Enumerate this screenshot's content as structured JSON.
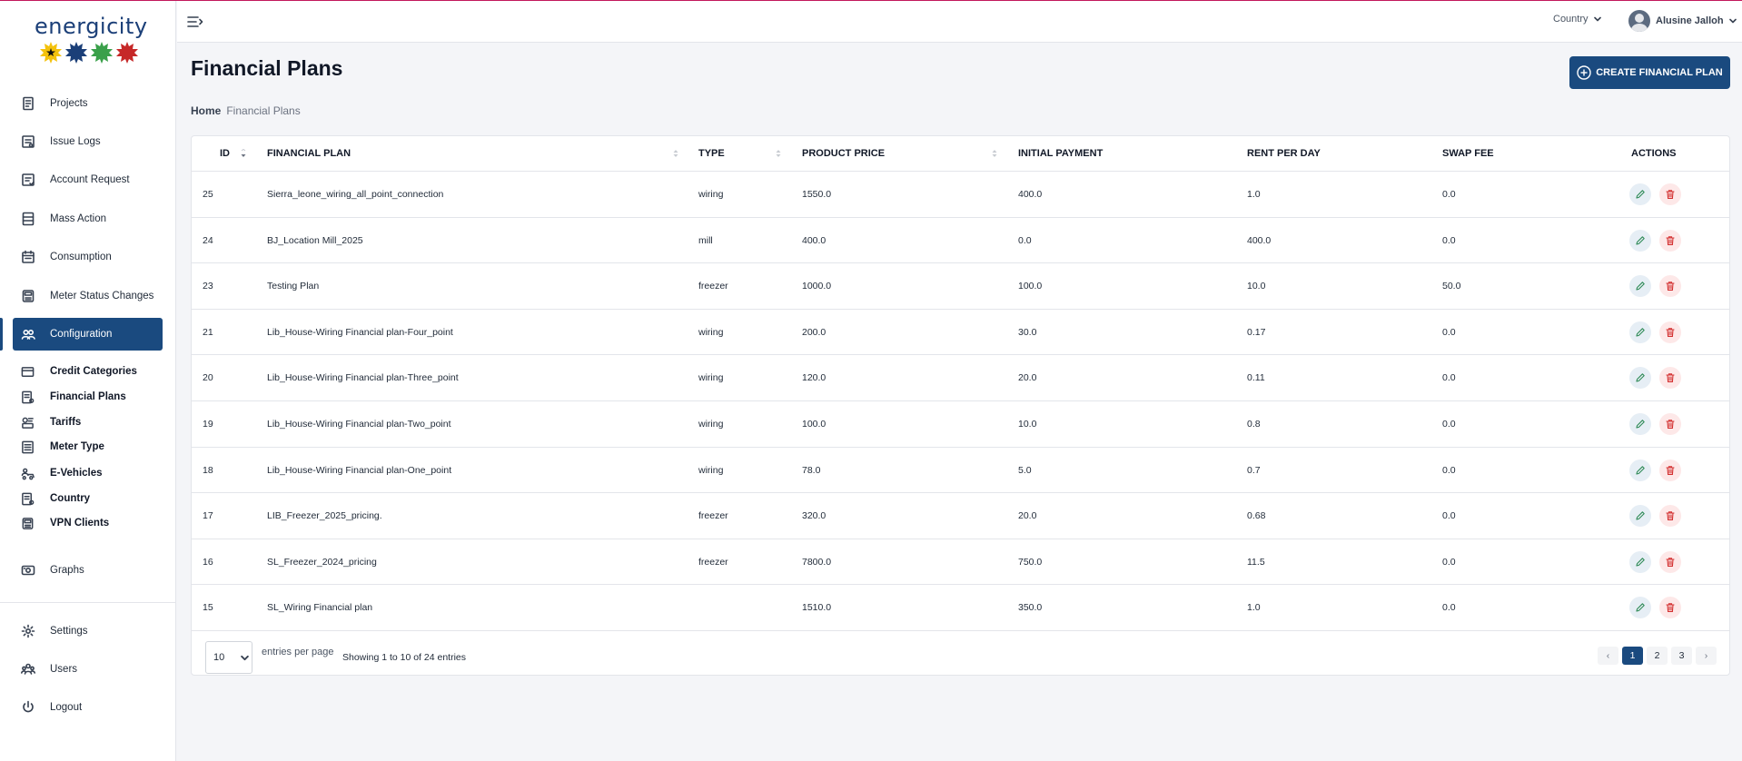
{
  "brand": {
    "name": "energicity",
    "colors": [
      "#f4c20d",
      "#1b3f78",
      "#3aa04a",
      "#c62828"
    ]
  },
  "sidebar": {
    "items": [
      {
        "label": "Projects",
        "icon": "document-icon"
      },
      {
        "label": "Issue Logs",
        "icon": "log-icon"
      },
      {
        "label": "Account Request",
        "icon": "request-icon"
      },
      {
        "label": "Mass Action",
        "icon": "list-icon"
      },
      {
        "label": "Consumption",
        "icon": "calendar-icon"
      },
      {
        "label": "Meter Status Changes",
        "icon": "meter-icon"
      },
      {
        "label": "Configuration",
        "icon": "users-icon",
        "active": true
      }
    ],
    "sub_items": [
      {
        "label": "Credit Categories",
        "icon": "card-icon"
      },
      {
        "label": "Financial Plans",
        "icon": "plan-icon"
      },
      {
        "label": "Tariffs",
        "icon": "tariff-icon"
      },
      {
        "label": "Meter Type",
        "icon": "meter-type-icon"
      },
      {
        "label": "E-Vehicles",
        "icon": "vehicle-icon"
      },
      {
        "label": "Country",
        "icon": "country-icon"
      },
      {
        "label": "VPN Clients",
        "icon": "vpn-icon"
      }
    ],
    "graphs": {
      "label": "Graphs",
      "icon": "graph-icon"
    },
    "bottom_items": [
      {
        "label": "Settings",
        "icon": "gear-icon"
      },
      {
        "label": "Users",
        "icon": "users-group-icon"
      },
      {
        "label": "Logout",
        "icon": "power-icon"
      }
    ]
  },
  "header": {
    "country_label": "Country",
    "user_name": "Alusine Jalloh"
  },
  "page": {
    "title": "Financial Plans",
    "create_button": "CREATE FINANCIAL PLAN",
    "breadcrumb": {
      "home": "Home",
      "current": "Financial Plans"
    }
  },
  "table": {
    "columns": [
      "ID",
      "FINANCIAL PLAN",
      "TYPE",
      "PRODUCT PRICE",
      "INITIAL PAYMENT",
      "RENT PER DAY",
      "SWAP FEE",
      "ACTIONS"
    ],
    "rows": [
      {
        "id": "25",
        "plan": "Sierra_leone_wiring_all_point_connection",
        "type": "wiring",
        "price": "1550.0",
        "initial": "400.0",
        "rent": "1.0",
        "swap": "0.0"
      },
      {
        "id": "24",
        "plan": "BJ_Location Mill_2025",
        "type": "mill",
        "price": "400.0",
        "initial": "0.0",
        "rent": "400.0",
        "swap": "0.0"
      },
      {
        "id": "23",
        "plan": "Testing Plan",
        "type": "freezer",
        "price": "1000.0",
        "initial": "100.0",
        "rent": "10.0",
        "swap": "50.0"
      },
      {
        "id": "21",
        "plan": "Lib_House-Wiring Financial plan-Four_point",
        "type": "wiring",
        "price": "200.0",
        "initial": "30.0",
        "rent": "0.17",
        "swap": "0.0"
      },
      {
        "id": "20",
        "plan": "Lib_House-Wiring Financial plan-Three_point",
        "type": "wiring",
        "price": "120.0",
        "initial": "20.0",
        "rent": "0.11",
        "swap": "0.0"
      },
      {
        "id": "19",
        "plan": "Lib_House-Wiring Financial plan-Two_point",
        "type": "wiring",
        "price": "100.0",
        "initial": "10.0",
        "rent": "0.8",
        "swap": "0.0"
      },
      {
        "id": "18",
        "plan": "Lib_House-Wiring Financial plan-One_point",
        "type": "wiring",
        "price": "78.0",
        "initial": "5.0",
        "rent": "0.7",
        "swap": "0.0"
      },
      {
        "id": "17",
        "plan": "LIB_Freezer_2025_pricing.",
        "type": "freezer",
        "price": "320.0",
        "initial": "20.0",
        "rent": "0.68",
        "swap": "0.0"
      },
      {
        "id": "16",
        "plan": "SL_Freezer_2024_pricing",
        "type": "freezer",
        "price": "7800.0",
        "initial": "750.0",
        "rent": "11.5",
        "swap": "0.0"
      },
      {
        "id": "15",
        "plan": "SL_Wiring Financial plan",
        "type": "",
        "price": "1510.0",
        "initial": "350.0",
        "rent": "1.0",
        "swap": "0.0"
      }
    ],
    "per_page": "10",
    "per_page_label": "entries per page",
    "showing": "Showing 1 to 10 of 24 entries",
    "pages": [
      "1",
      "2",
      "3"
    ],
    "current_page": "1",
    "prev": "‹",
    "next": "›"
  }
}
